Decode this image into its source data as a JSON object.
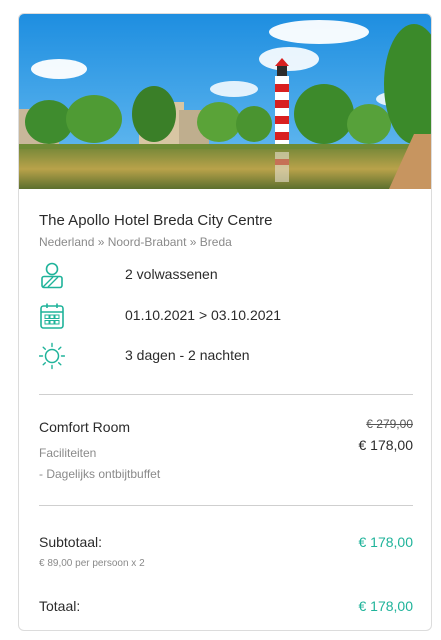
{
  "hotel": {
    "name": "The Apollo Hotel Breda City Centre",
    "location": "Nederland » Noord-Brabant » Breda"
  },
  "details": [
    {
      "icon": "person-icon",
      "text": "2 volwassenen"
    },
    {
      "icon": "calendar-icon",
      "text": "01.10.2021 > 03.10.2021"
    },
    {
      "icon": "sun-icon",
      "text": "3 dagen - 2 nachten"
    }
  ],
  "room": {
    "name": "Comfort Room",
    "old_price": "€ 279,00",
    "price": "€ 178,00",
    "facilities_title": "Faciliteiten",
    "facilities": [
      "- Dagelijks ontbijtbuffet"
    ]
  },
  "summary": {
    "subtotal_label": "Subtotaal:",
    "subtotal_note": "€ 89,00 per persoon x 2",
    "subtotal_value": "€ 178,00",
    "total_label": "Totaal:",
    "total_value": "€ 178,00"
  },
  "colors": {
    "accent": "#1fb39a",
    "muted": "#8a8a8a",
    "text": "#2b2b2b"
  }
}
